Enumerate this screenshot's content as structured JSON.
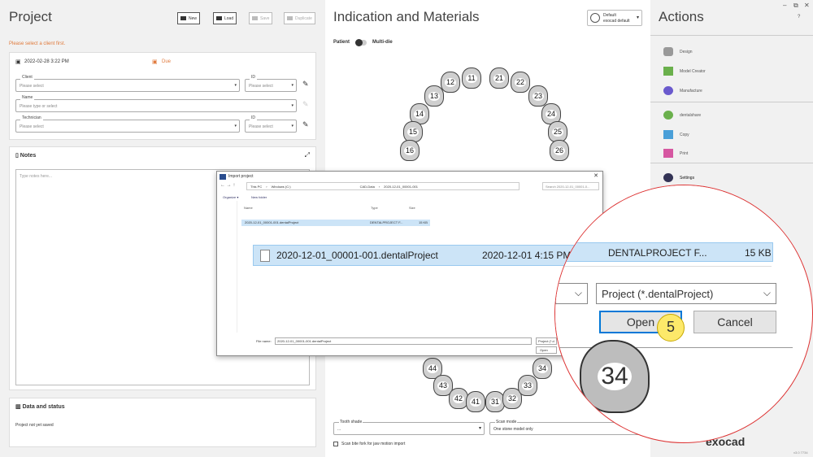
{
  "project": {
    "title": "Project",
    "buttons": {
      "new": "New",
      "load": "Load",
      "save": "Save",
      "duplicate": "Duplicate"
    },
    "warning": "Please select a client first.",
    "date": "2022-02-28 3:22 PM",
    "due": "Due",
    "client_label": "Client",
    "client_ph": "Please select",
    "id_label": "ID",
    "id_ph": "Please select",
    "name_label": "Name",
    "name_ph": "Please type or select",
    "tech_label": "Technician",
    "tech_ph": "Please select",
    "tech_id_label": "ID",
    "tech_id_ph": "Please select",
    "notes_title": "Notes",
    "notes_ph": "Type notes here...",
    "data_title": "Data and status",
    "data_text": "Project not yet saved"
  },
  "indication": {
    "title": "Indication and Materials",
    "preset_line1": "Default",
    "preset_line2": "exocad default",
    "patient": "Patient",
    "multidie": "Multi-die",
    "teeth_upper": [
      "11",
      "12",
      "13",
      "14",
      "15",
      "16",
      "21",
      "22",
      "23",
      "24",
      "25",
      "26"
    ],
    "teeth_lower": [
      "44",
      "43",
      "42",
      "41",
      "31",
      "32",
      "33",
      "34"
    ],
    "tooth_shade_label": "Tooth shade",
    "tooth_shade_value": "...",
    "scan_mode_label": "Scan mode",
    "scan_mode_value": "One stone model only",
    "bite_fork": "Scan bite fork for jaw motion import"
  },
  "actions": {
    "title": "Actions",
    "items": [
      "Design",
      "Model Creator",
      "Manufacture",
      "dentalshare",
      "Copy",
      "Print",
      "Settings"
    ],
    "brand": "exocad",
    "version": "v3.0 7734",
    "help": "?"
  },
  "dialog": {
    "title": "Import project",
    "path": [
      "This PC",
      "Windows (C:)",
      "CAD-Data",
      "2020-12-01_00001-001"
    ],
    "search_ph": "Search 2020-12-01_00001-0...",
    "organize": "Organize ▾",
    "new_folder": "New folder",
    "columns": [
      "Name",
      "Type",
      "Size"
    ],
    "row": {
      "name": "2020-12-01_00001-001.dentalProject",
      "type": "DENTALPROJECT F...",
      "size": "15 KB"
    },
    "filename_label": "File name:",
    "filename": "2020-12-01_00001-001.dentalProject",
    "filter_small": "Project (*.d",
    "open_small": "Open"
  },
  "zoomed": {
    "row_name": "2020-12-01_00001-001.dentalProject",
    "row_date": "2020-12-01 4:15 PM",
    "row_type": "DENTALPROJECT F...",
    "row_size": "15 KB",
    "filter": "Project (*.dentalProject)",
    "open": "Open",
    "cancel": "Cancel",
    "step": "5",
    "tooth": "34"
  }
}
